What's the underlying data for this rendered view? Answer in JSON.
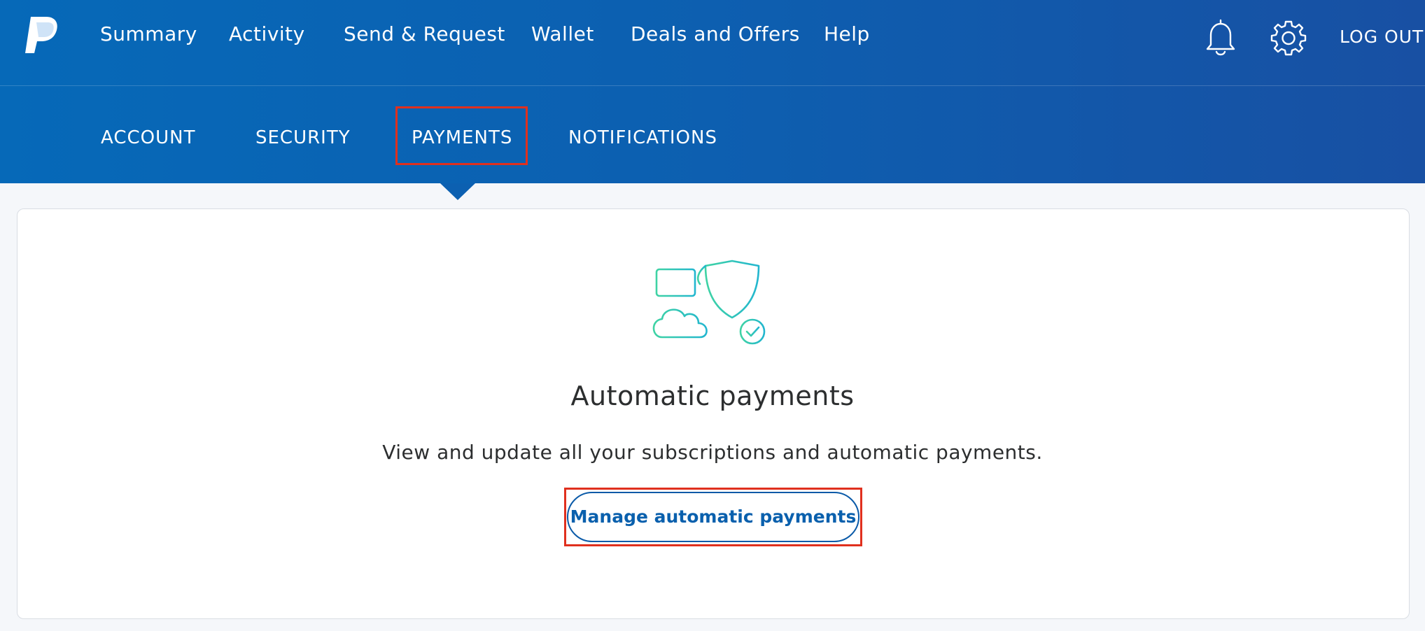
{
  "topnav": {
    "items": [
      {
        "label": "Summary"
      },
      {
        "label": "Activity"
      },
      {
        "label": "Send & Request"
      },
      {
        "label": "Wallet"
      },
      {
        "label": "Deals and Offers"
      },
      {
        "label": "Help"
      }
    ],
    "logout_label": "LOG OUT"
  },
  "subnav": {
    "items": [
      {
        "label": "ACCOUNT"
      },
      {
        "label": "SECURITY"
      },
      {
        "label": "PAYMENTS",
        "active": true
      },
      {
        "label": "NOTIFICATIONS"
      }
    ]
  },
  "card": {
    "title": "Automatic payments",
    "description": "View and update all your subscriptions and automatic payments.",
    "button_label": "Manage automatic payments"
  },
  "colors": {
    "header_start": "#0669b8",
    "header_end": "#1850a3",
    "highlight": "#e0301e",
    "button_text": "#0a60ad",
    "illustration": "#2ec4b6"
  },
  "icons": [
    "paypal-logo-icon",
    "bell-icon",
    "gear-icon",
    "payments-illustration-icon"
  ]
}
